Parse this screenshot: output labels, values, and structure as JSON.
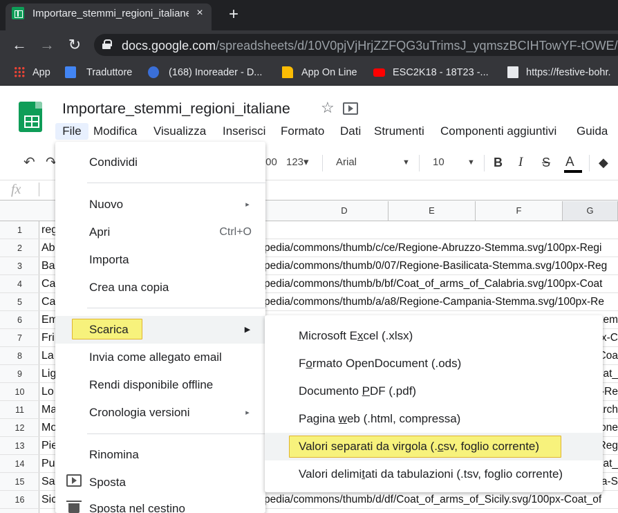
{
  "browser": {
    "tab_title": "Importare_stemmi_regioni_italiane",
    "tab_close": "×",
    "new_tab": "+",
    "back": "←",
    "forward": "→",
    "reload": "↻",
    "url_host": "docs.google.com",
    "url_path": "/spreadsheets/d/10V0pjVjHrjZZFQG3uTrimsJ_yqmszBCIHTowYF-tOWE/edit#",
    "bookmarks": [
      {
        "label": "App",
        "icon": "apps-grid-icon"
      },
      {
        "label": "Traduttore",
        "icon": "google-translate-icon"
      },
      {
        "label": "(168) Inoreader - D...",
        "icon": "inoreader-icon"
      },
      {
        "label": "App On Line",
        "icon": "folder-icon"
      },
      {
        "label": "ESC2K18 - 18T23 -...",
        "icon": "youtube-icon"
      },
      {
        "label": "https://festive-bohr.",
        "icon": "page-icon"
      }
    ]
  },
  "doc": {
    "title": "Importare_stemmi_regioni_italiane",
    "star": "☆"
  },
  "menubar": [
    "File",
    "Modifica",
    "Visualizza",
    "Inserisci",
    "Formato",
    "Dati",
    "Strumenti",
    "Componenti aggiuntivi",
    "Guida"
  ],
  "toolbar": {
    "undo": "↶",
    "redo": "↷",
    "decimals": ".00",
    "number_format": "123",
    "number_format_arrow": "▾",
    "font": "Arial",
    "font_arrow": "▼",
    "font_size": "10",
    "size_arrow": "▼",
    "bold": "B",
    "italic": "I",
    "strike": "S",
    "text_color": "A",
    "text_color_value": "#000000",
    "fill": "◆"
  },
  "formula_bar": {
    "fx": "fx"
  },
  "columns": [
    "D",
    "E",
    "F",
    "G"
  ],
  "rows": [
    {
      "n": "1",
      "a": "reg",
      "url": ""
    },
    {
      "n": "2",
      "a": "Ab",
      "url": "pedia/commons/thumb/c/ce/Regione-Abruzzo-Stemma.svg/100px-Regi"
    },
    {
      "n": "3",
      "a": "Ba",
      "url": "pedia/commons/thumb/0/07/Regione-Basilicata-Stemma.svg/100px-Reg"
    },
    {
      "n": "4",
      "a": "Ca",
      "url": "pedia/commons/thumb/b/bf/Coat_of_arms_of_Calabria.svg/100px-Coat"
    },
    {
      "n": "5",
      "a": "Ca",
      "url": "pedia/commons/thumb/a/a8/Regione-Campania-Stemma.svg/100px-Re"
    },
    {
      "n": "6",
      "a": "Em",
      "url": "tem"
    },
    {
      "n": "7",
      "a": "Fri",
      "url": "x-C"
    },
    {
      "n": "8",
      "a": "La",
      "url": "Coa"
    },
    {
      "n": "9",
      "a": "Lig",
      "url": "oat_"
    },
    {
      "n": "10",
      "a": "Lo",
      "url": "t-Re"
    },
    {
      "n": "11",
      "a": "Ma",
      "url": "arch"
    },
    {
      "n": "12",
      "a": "Mo",
      "url": "one"
    },
    {
      "n": "13",
      "a": "Pie",
      "url": "Reg"
    },
    {
      "n": "14",
      "a": "Pu",
      "url": "oat_"
    },
    {
      "n": "15",
      "a": "Sa",
      "url": "a-S"
    },
    {
      "n": "16",
      "a": "Sic",
      "url": "pedia/commons/thumb/d/df/Coat_of_arms_of_Sicily.svg/100px-Coat_of"
    }
  ],
  "file_menu": {
    "condividi": "Condividi",
    "nuovo": "Nuovo",
    "apri": "Apri",
    "apri_shortcut": "Ctrl+O",
    "importa": "Importa",
    "crea_copia": "Crea una copia",
    "scarica": "Scarica",
    "invia": "Invia come allegato email",
    "offline": "Rendi disponibile offline",
    "cronologia": "Cronologia versioni",
    "rinomina": "Rinomina",
    "sposta": "Sposta",
    "cestino": "Sposta nel cestino",
    "arrow": "▸",
    "arrow_sel": "▶"
  },
  "download_menu": {
    "xlsx_a": "Microsoft E",
    "xlsx_u": "x",
    "xlsx_b": "cel (.xlsx)",
    "ods_a": "F",
    "ods_u": "o",
    "ods_b": "rmato OpenDocument (.ods)",
    "pdf_a": "Documento ",
    "pdf_u": "P",
    "pdf_b": "DF (.pdf)",
    "html_a": "Pagina ",
    "html_u": "w",
    "html_b": "eb (.html, compressa)",
    "csv_a": "Valori separati da virgola (.",
    "csv_u": "c",
    "csv_b": "sv, foglio corrente)",
    "tsv_a": "Valori delimi",
    "tsv_u": "t",
    "tsv_b": "ati da tabulazioni (.tsv, foglio corrente)"
  },
  "highlight_color": "#f7f27c"
}
